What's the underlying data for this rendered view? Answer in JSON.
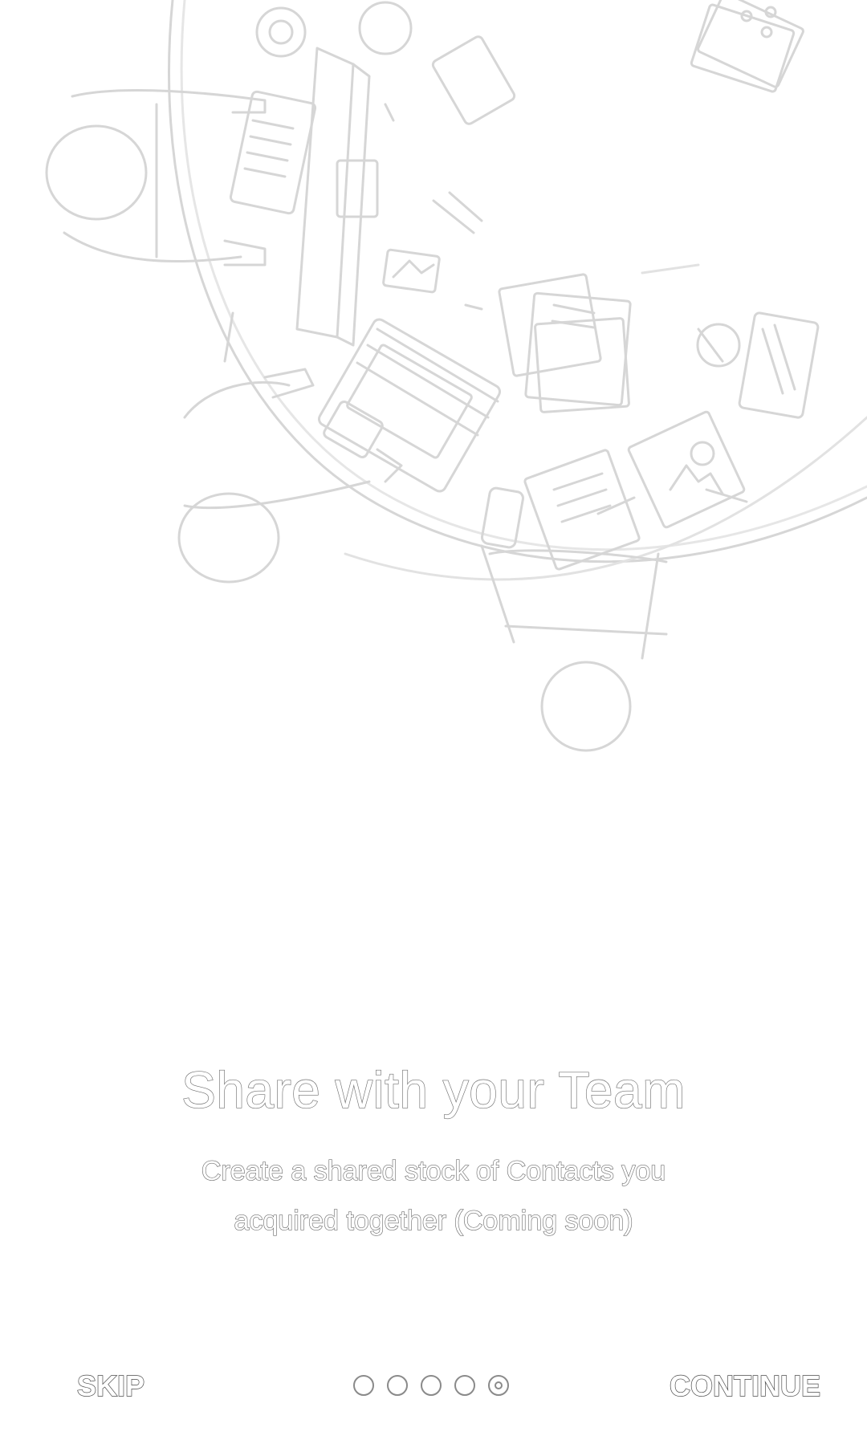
{
  "onboarding": {
    "title": "Share with your Team",
    "subtitle_line1": "Create a shared stock of Contacts you",
    "subtitle_line2": "acquired together (Coming soon)",
    "skip_label": "SKIP",
    "continue_label": "CONTINUE",
    "page_count": 5,
    "current_page": 5,
    "illustration_icon": "team-desk-illustration"
  },
  "colors": {
    "background": "#ffffff",
    "outline": "#6f6f6f",
    "illustration_stroke": "#d4d4d4"
  }
}
